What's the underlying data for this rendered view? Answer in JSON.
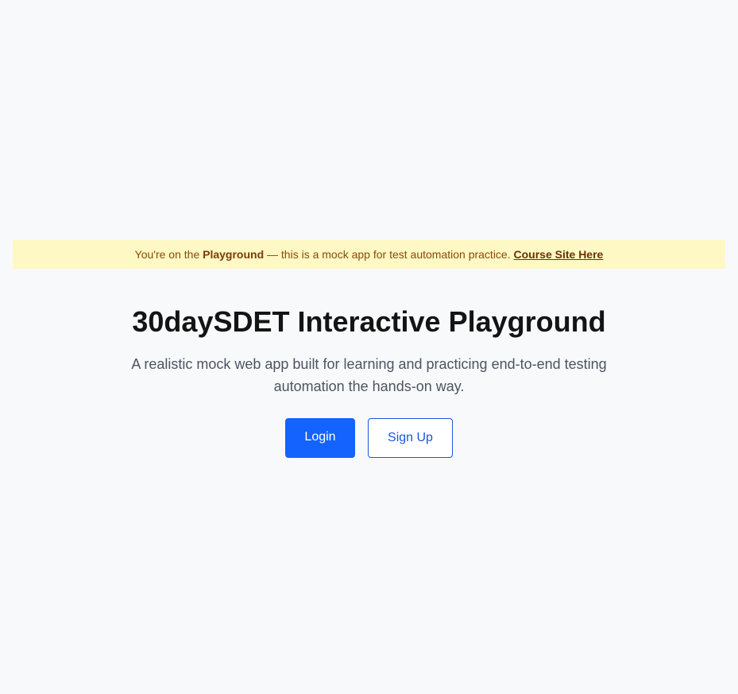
{
  "banner": {
    "prefix": "You're on the ",
    "highlight": "Playground",
    "middle": " — this is a mock app for test automation practice. ",
    "link_label": "Course Site Here"
  },
  "hero": {
    "title": "30daySDET Interactive Playground",
    "description": "A realistic mock web app built for learning and practicing end-to-end testing automation the hands-on way."
  },
  "actions": {
    "login_label": "Login",
    "signup_label": "Sign Up"
  },
  "colors": {
    "background": "#f8f9fb",
    "banner_background": "#fef8c4",
    "banner_text": "#8a4b06",
    "primary": "#1463ff",
    "outline": "#1a56db",
    "heading": "#141414",
    "body_text": "#4b5563"
  }
}
